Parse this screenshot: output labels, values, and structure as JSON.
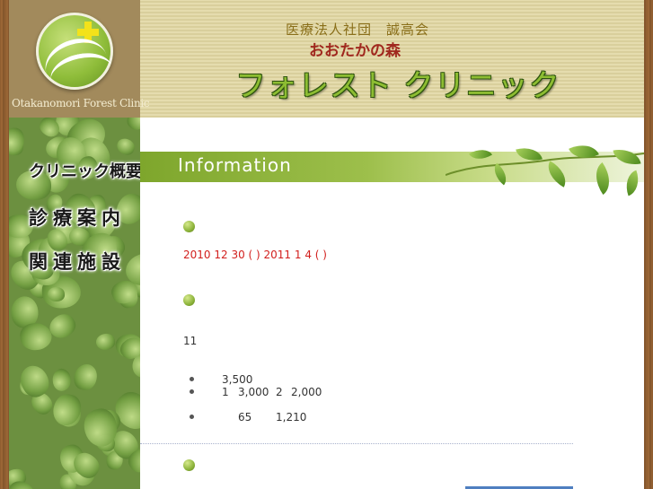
{
  "header": {
    "logo_text": "Otakanomori Forest Clinic",
    "org_name": "医療法人社団　誠高会",
    "sub_name": "おおたかの森",
    "clinic_name": "フォレスト クリニック"
  },
  "sidebar": {
    "items": [
      {
        "label": "クリニック概要"
      },
      {
        "label": "診療案内"
      },
      {
        "label": "関連施設"
      }
    ]
  },
  "main": {
    "section_title": "Information",
    "notice": "2010 12 30 ( ) 2011 1 4 ( )",
    "paragraph": "11",
    "list": [
      {
        "col1": "",
        "col2": "3,500",
        "col3": "",
        "col4": ""
      },
      {
        "col1": "1",
        "col2": "3,000",
        "col3": "2",
        "col4": "2,000"
      },
      {
        "col1": "",
        "col2": "65",
        "col3": "1,210",
        "col4": ""
      }
    ]
  },
  "colors": {
    "accent_green": "#8dbd32",
    "notice_red": "#d2201e",
    "frame_brown": "#8a5a2e"
  }
}
